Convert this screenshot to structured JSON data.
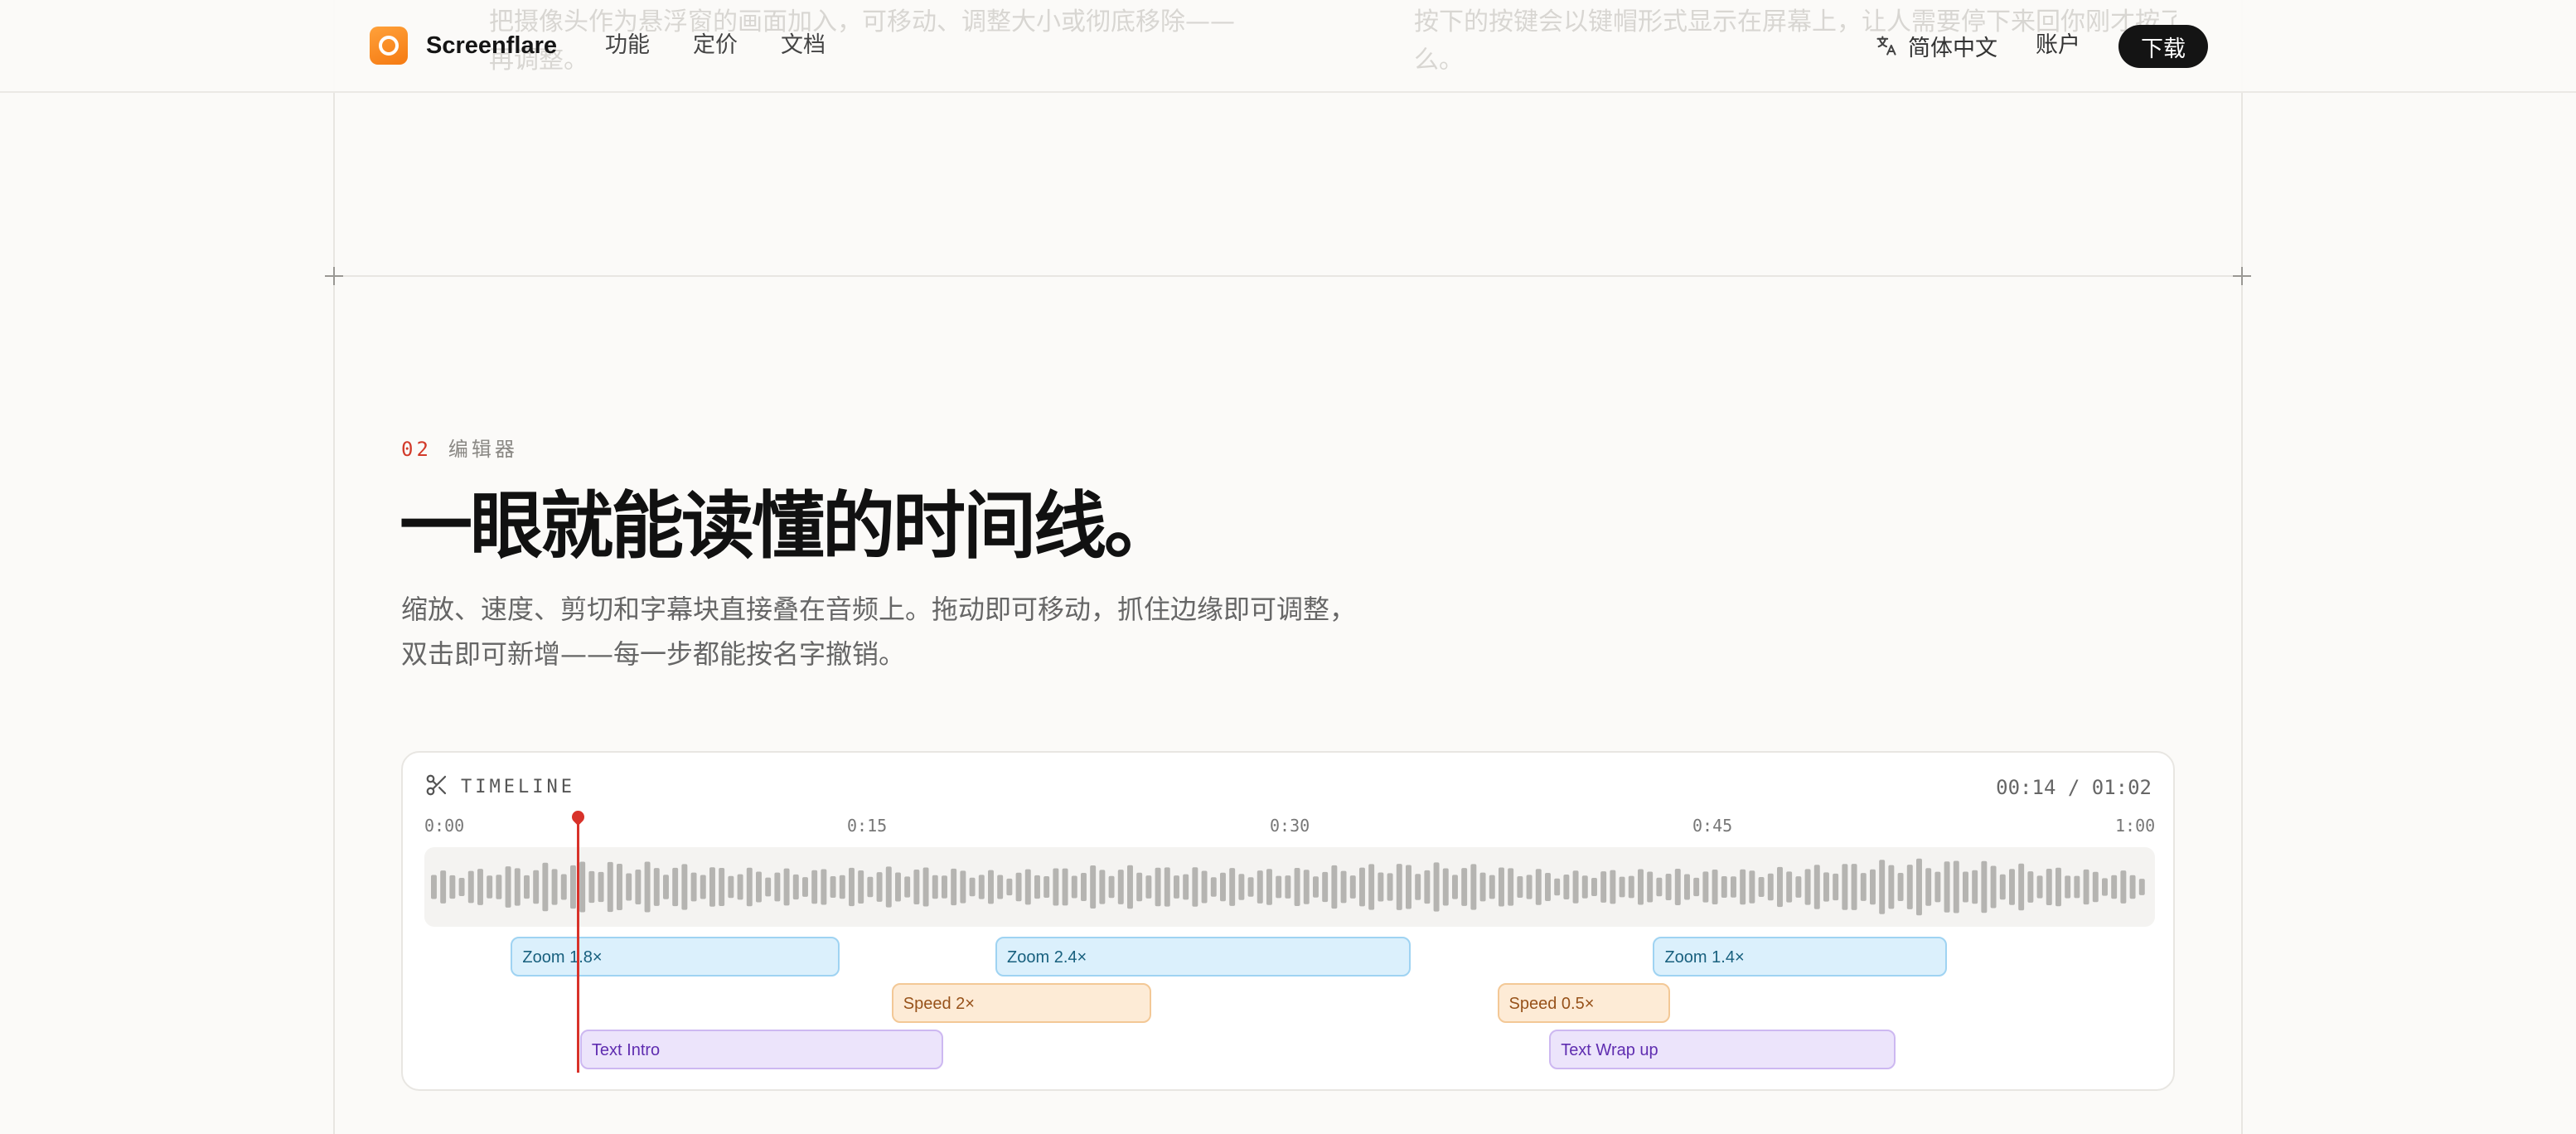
{
  "header": {
    "brand": "Screenflare",
    "nav": [
      "功能",
      "定价",
      "文档"
    ],
    "language": "简体中文",
    "account": "账户",
    "download": "下载",
    "ghost_left": "把摄像头作为悬浮窗的画面加入，可移动、调整大小或彻底移除——录完",
    "ghost_left_2": "再调整。",
    "ghost_right": "按下的按键会以键帽形式显示在屏幕上，让人需要停下来回你刚才按了什",
    "ghost_right_2": "么。"
  },
  "section": {
    "number": "02",
    "label": "编辑器",
    "headline": "一眼就能读懂的时间线。",
    "desc_line1": "缩放、速度、剪切和字幕块直接叠在音频上。拖动即可移动，抓住边缘即可调整，",
    "desc_line2": "双击即可新增——每一步都能按名字撤销。"
  },
  "timeline": {
    "title": "TIMELINE",
    "time": "00:14 / 01:02",
    "ticks": [
      "0:00",
      "0:15",
      "0:30",
      "0:45",
      "1:00"
    ],
    "colors": {
      "zoom": "#9fd3f2",
      "speed": "#f3c896",
      "text": "#cdb8f1",
      "playhead": "#d8322a",
      "wave": "#b5b4b1"
    },
    "clips": [
      {
        "type": "zoom",
        "label": "Zoom 1.8×",
        "start": 0.05,
        "end": 0.24
      },
      {
        "type": "zoom",
        "label": "Zoom 2.4×",
        "start": 0.33,
        "end": 0.57
      },
      {
        "type": "zoom",
        "label": "Zoom 1.4×",
        "start": 0.71,
        "end": 0.88
      },
      {
        "type": "speed",
        "label": "Speed 2×",
        "start": 0.27,
        "end": 0.42
      },
      {
        "type": "speed",
        "label": "Speed 0.5×",
        "start": 0.62,
        "end": 0.72
      },
      {
        "type": "text",
        "label": "Text Intro",
        "start": 0.09,
        "end": 0.3
      },
      {
        "type": "text",
        "label": "Text Wrap up",
        "start": 0.65,
        "end": 0.85
      }
    ]
  }
}
